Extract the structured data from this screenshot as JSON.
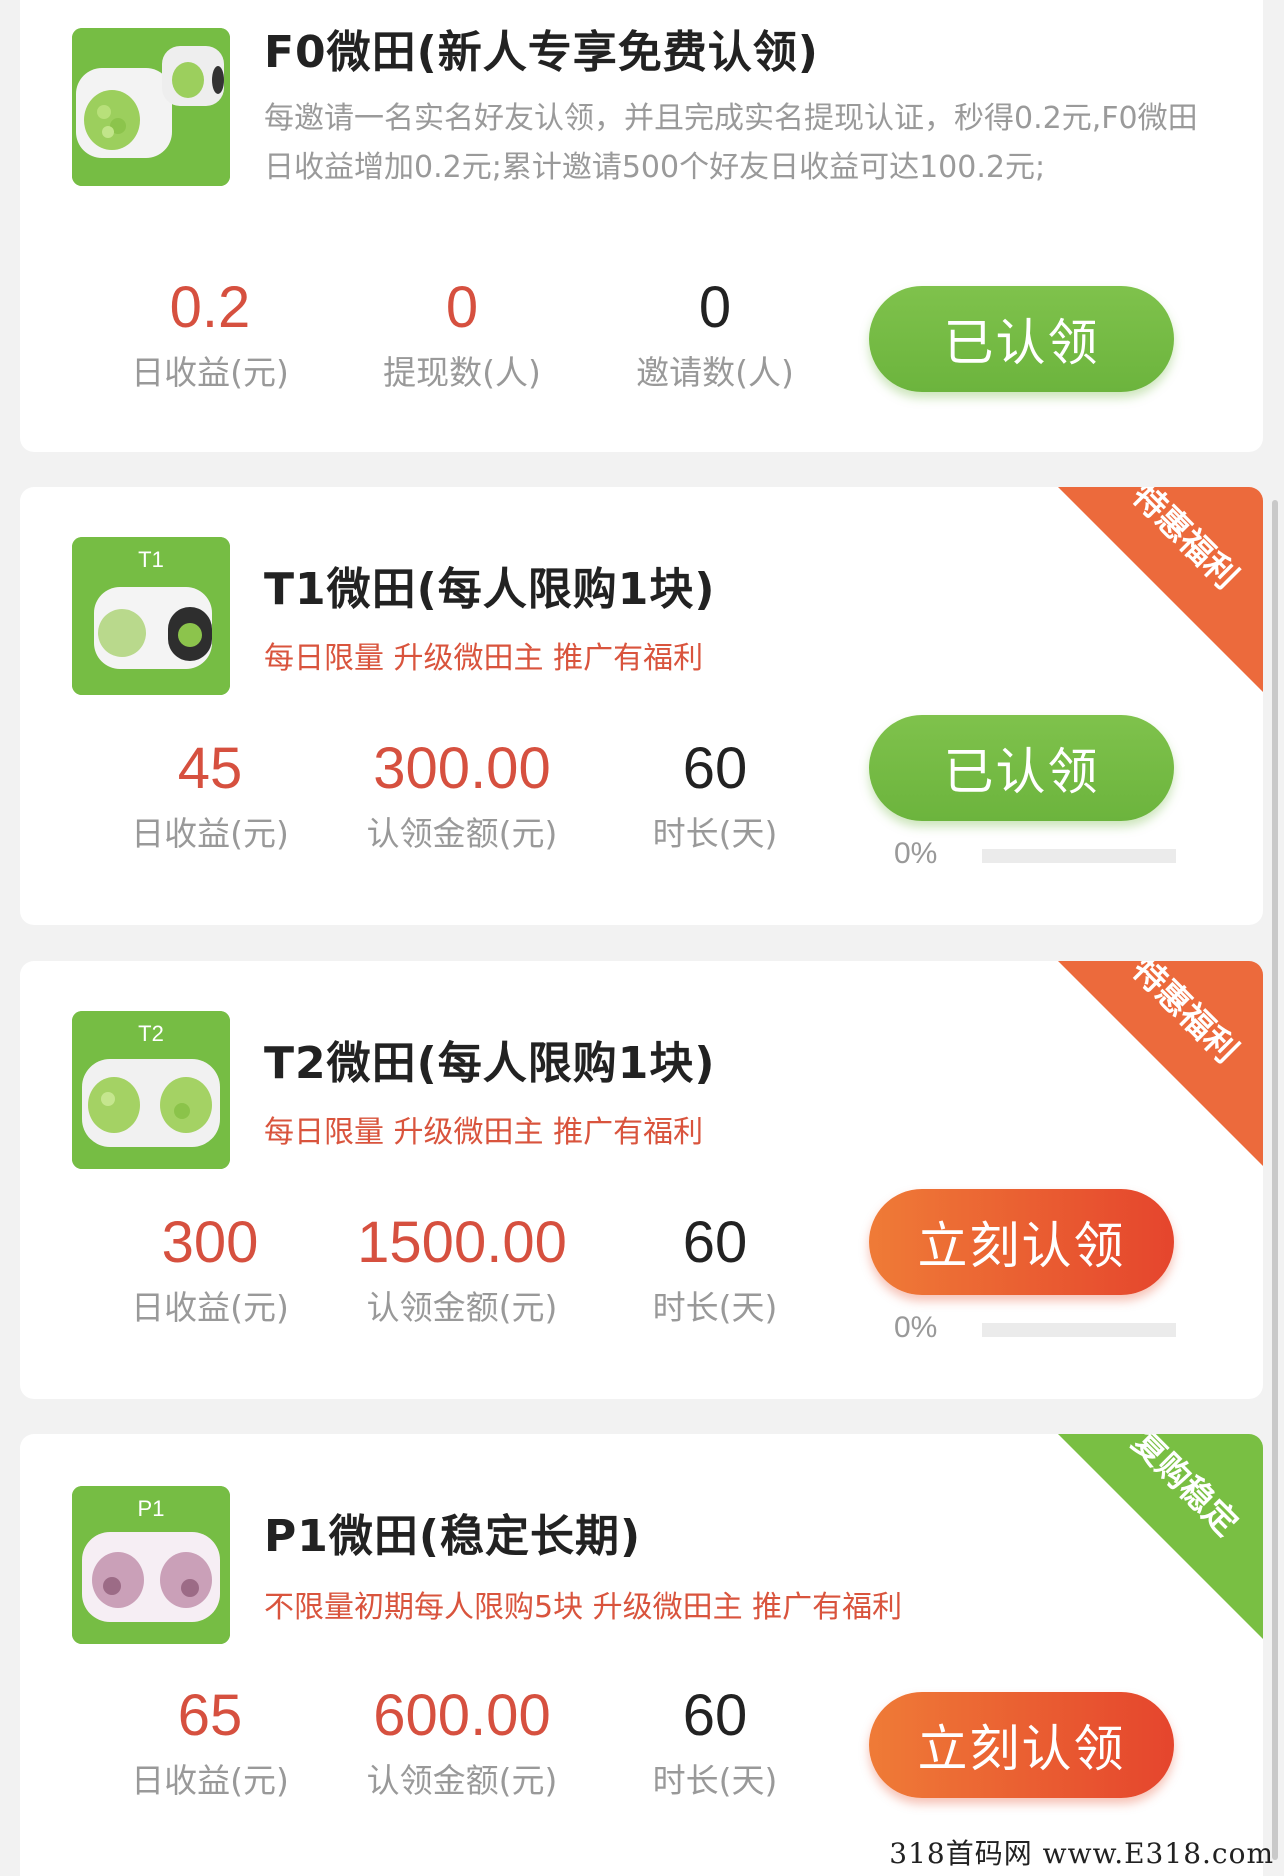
{
  "colors": {
    "accent_red": "#d6503f",
    "green_button": "#6cb43d",
    "orange_button": "#e5452d",
    "ribbon_orange": "#ec6a3c",
    "ribbon_green": "#79bf43"
  },
  "cards": [
    {
      "title": "F0微田(新人专享免费认领)",
      "description": "每邀请一名实名好友认领，并且完成实名提现认证，秒得0.2元,F0微田日收益增加0.2元;累计邀请500个好友日收益可达100.2元;",
      "image_tag": "",
      "stats": [
        {
          "value": "0.2",
          "label": "日收益(元)"
        },
        {
          "value": "0",
          "label": "提现数(人)"
        },
        {
          "value": "0",
          "label": "邀请数(人)"
        }
      ],
      "button": "已认领"
    },
    {
      "title": "T1微田(每人限购1块)",
      "promo": "每日限量 升级微田主 推广有福利",
      "image_tag": "T1",
      "ribbon": "特惠福利",
      "stats": [
        {
          "value": "45",
          "label": "日收益(元)"
        },
        {
          "value": "300.00",
          "label": "认领金额(元)"
        },
        {
          "value": "60",
          "label": "时长(天)"
        }
      ],
      "button": "已认领",
      "progress_text": "0%",
      "progress": 0
    },
    {
      "title": "T2微田(每人限购1块)",
      "promo": "每日限量 升级微田主 推广有福利",
      "image_tag": "T2",
      "ribbon": "特惠福利",
      "stats": [
        {
          "value": "300",
          "label": "日收益(元)"
        },
        {
          "value": "1500.00",
          "label": "认领金额(元)"
        },
        {
          "value": "60",
          "label": "时长(天)"
        }
      ],
      "button": "立刻认领",
      "progress_text": "0%",
      "progress": 0
    },
    {
      "title": "P1微田(稳定长期)",
      "promo": "不限量初期每人限购5块 升级微田主 推广有福利",
      "image_tag": "P1",
      "ribbon": "复购稳定",
      "stats": [
        {
          "value": "65",
          "label": "日收益(元)"
        },
        {
          "value": "600.00",
          "label": "认领金额(元)"
        },
        {
          "value": "60",
          "label": "时长(天)"
        }
      ],
      "button": "立刻认领"
    }
  ],
  "watermark": "318首码网 www.E318.com"
}
